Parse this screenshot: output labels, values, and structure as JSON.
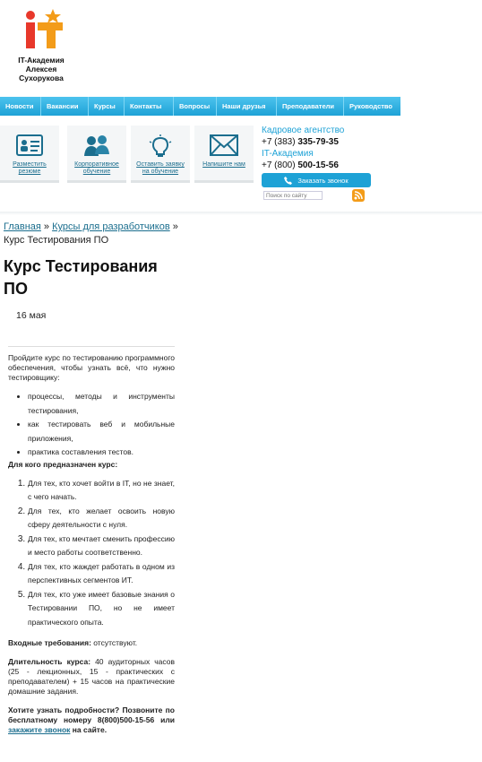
{
  "logo": {
    "line1": "IT-Академия",
    "line2": "Алексея Сухорукова"
  },
  "nav": [
    "Новости",
    "Вакансии",
    "Курсы",
    "Контакты",
    "Вопросы",
    "Наши друзья",
    "Преподаватели",
    "Руководство"
  ],
  "tiles": [
    {
      "label1": "Разместить",
      "label2": "резюме",
      "icon": "resume-icon"
    },
    {
      "label1": "Корпоративное",
      "label2": "обучение",
      "icon": "people-icon"
    },
    {
      "label1": "Оставить заявку",
      "label2": "на обучение",
      "icon": "lightbulb-icon"
    },
    {
      "label1": "Напишите нам",
      "label2": "",
      "icon": "envelope-icon"
    }
  ],
  "contacts": {
    "label1": "Кадровое агентство",
    "phone1_prefix": "+7 (383) ",
    "phone1_num": "335-79-35",
    "label2": "IT-Академия",
    "phone2_prefix": "+7 (800) ",
    "phone2_num": "500-15-56",
    "call_button": "Заказать звонок",
    "search_placeholder": "Поиск по сайту"
  },
  "breadcrumb": {
    "home": "Главная",
    "sep": " » ",
    "section": "Курсы для разработчиков",
    "sep2": " »",
    "current": "Курс Тестирования ПО"
  },
  "article": {
    "title": "Курс Тестирования ПО",
    "date": "16 мая",
    "intro": "Пройдите курс по тестированию программного обеспечения, чтобы узнать всё, что нужно тестировщику:",
    "bullets": [
      "процессы, методы и инструменты тестирования,",
      "как тестировать веб и мобильные приложения,",
      "практика составления тестов."
    ],
    "audience_title": "Для кого предназначен курс:",
    "audience": [
      "Для тех, кто хочет войти в IT, но не знает, с чего начать.",
      "Для тех, кто желает освоить новую сферу деятельности с нуля.",
      "Для тех, кто мечтает сменить профессию и место работы соответственно.",
      "Для тех, кто жаждет работать в одном из перспективных сегментов ИТ.",
      "Для тех, кто уже имеет базовые знания о Тестировании ПО, но не имеет практического опыта."
    ],
    "req_label": "Входные требования:",
    "req_value": " отсутствуют.",
    "dur_label": "Длительность курса:",
    "dur_value": " 40 аудиторных часов (25 - лекционных, 15 - практических с преподавателем) + 15 часов на практические домашние задания.",
    "cta_text": "Хотите узнать подробности? Позвоните по бесплатному номеру 8(800)500-15-56 или ",
    "cta_link": "закажите звонок",
    "cta_end": " на сайте."
  }
}
